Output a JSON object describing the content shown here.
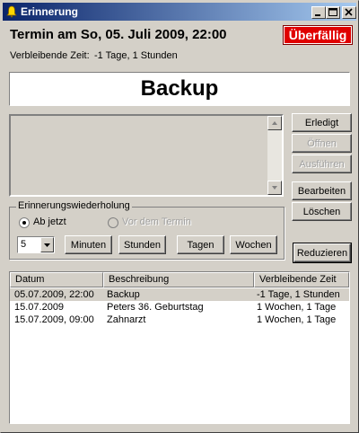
{
  "window": {
    "title": "Erinnerung"
  },
  "header": {
    "heading": "Termin am So, 05. Juli 2009, 22:00",
    "status_badge": "Überfällig",
    "status_color": "#e00000",
    "remaining_label": "Verbleibende Zeit:",
    "remaining_value": "-1 Tage, 1 Stunden"
  },
  "subject": "Backup",
  "notes": "",
  "side_buttons": {
    "done": "Erledigt",
    "open": "Öffnen",
    "execute": "Ausführen",
    "edit": "Bearbeiten",
    "delete": "Löschen",
    "reduce": "Reduzieren"
  },
  "repeat_group": {
    "legend": "Erinnerungswiederholung",
    "from_now": "Ab jetzt",
    "before_event": "Vor dem Termin",
    "selected": "Ab jetzt",
    "amount": "5",
    "units": [
      "Minuten",
      "Stunden",
      "Tagen",
      "Wochen"
    ]
  },
  "list": {
    "columns": [
      "Datum",
      "Beschreibung",
      "Verbleibende Zeit"
    ],
    "rows": [
      {
        "date": "05.07.2009, 22:00",
        "description": "Backup",
        "remaining": "-1 Tage, 1 Stunden",
        "selected": true
      },
      {
        "date": "15.07.2009",
        "description": "Peters 36. Geburtstag",
        "remaining": "1 Wochen, 1 Tage",
        "selected": false
      },
      {
        "date": "15.07.2009, 09:00",
        "description": "Zahnarzt",
        "remaining": "1 Wochen, 1 Tage",
        "selected": false
      }
    ]
  }
}
